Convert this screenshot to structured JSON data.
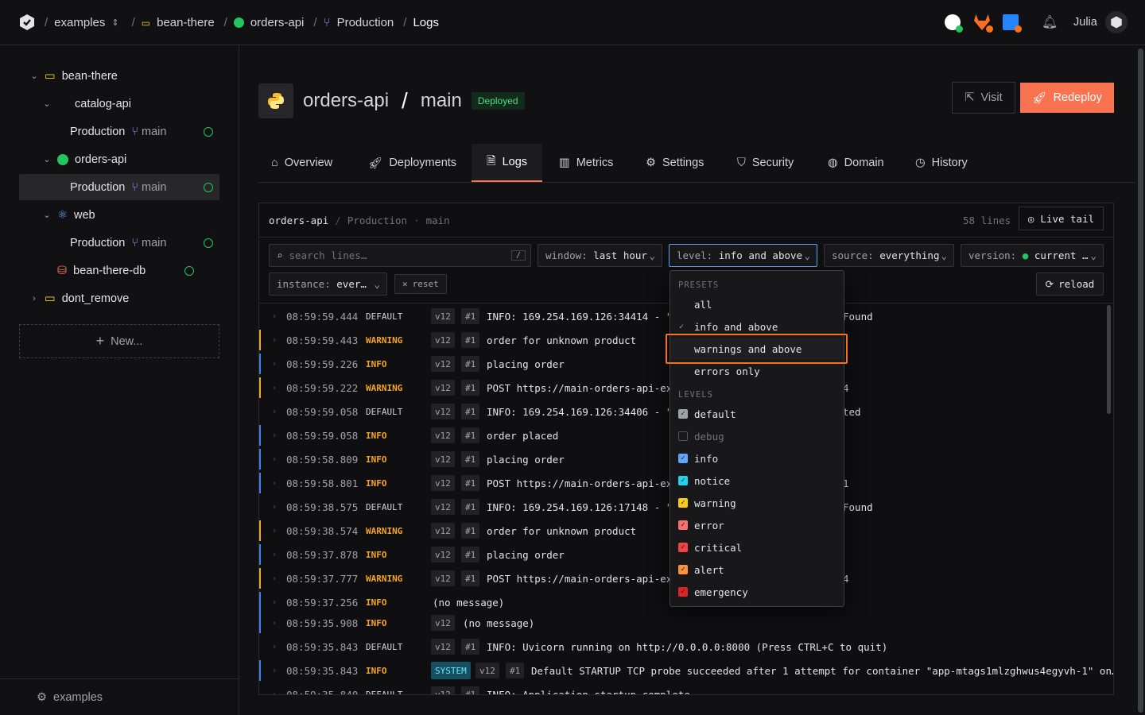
{
  "breadcrumb": {
    "org": "examples",
    "project": "bean-there",
    "service": "orders-api",
    "env": "Production",
    "page": "Logs"
  },
  "user": {
    "name": "Julia"
  },
  "sidebar": {
    "tree": [
      {
        "label": "bean-there"
      },
      {
        "label": "catalog-api"
      },
      {
        "label": "Production",
        "branch": "main"
      },
      {
        "label": "orders-api"
      },
      {
        "label": "Production",
        "branch": "main"
      },
      {
        "label": "web"
      },
      {
        "label": "Production",
        "branch": "main"
      },
      {
        "label": "bean-there-db"
      },
      {
        "label": "dont_remove"
      }
    ],
    "new_label": "New...",
    "footer": "examples"
  },
  "header": {
    "service": "orders-api",
    "slash": "/",
    "branch": "main",
    "status": "Deployed",
    "visit": "Visit",
    "redeploy": "Redeploy"
  },
  "tabs": [
    "Overview",
    "Deployments",
    "Logs",
    "Metrics",
    "Settings",
    "Security",
    "Domain",
    "History"
  ],
  "logs": {
    "path": {
      "service": "orders-api",
      "sep": "/",
      "env": "Production",
      "dot": "·",
      "branch": "main"
    },
    "lines": "58 lines",
    "live_tail": "Live tail",
    "search_placeholder": "search lines…",
    "slash_key": "/",
    "filters": {
      "window": {
        "key": "window:",
        "value": "last hour"
      },
      "level": {
        "key": "level:",
        "value": "info and above"
      },
      "source": {
        "key": "source:",
        "value": "everything"
      },
      "version": {
        "key": "version:",
        "value": "current …"
      },
      "instance": {
        "key": "instance:",
        "value": "ever…"
      }
    },
    "reset": "reset",
    "reload": "reload",
    "rows": [
      {
        "time": "08:59:59.444",
        "level": "DEFAULT",
        "ver": "v12",
        "inst": "#1",
        "msg": "INFO: 169.254.169.126:34414 - \"P",
        "tail": "Found"
      },
      {
        "time": "08:59:59.443",
        "level": "WARNING",
        "ver": "v12",
        "inst": "#1",
        "msg": "order for unknown product",
        "tail": ""
      },
      {
        "time": "08:59:59.226",
        "level": "INFO",
        "ver": "v12",
        "inst": "#1",
        "msg": "placing order",
        "tail": ""
      },
      {
        "time": "08:59:59.222",
        "level": "WARNING",
        "ver": "v12",
        "inst": "#1",
        "msg": "POST https://main-orders-api-exa",
        "tail": "4"
      },
      {
        "time": "08:59:59.058",
        "level": "DEFAULT",
        "ver": "v12",
        "inst": "#1",
        "msg": "INFO: 169.254.169.126:34406 - \"P",
        "tail": "ted"
      },
      {
        "time": "08:59:59.058",
        "level": "INFO",
        "ver": "v12",
        "inst": "#1",
        "msg": "order placed",
        "tail": ""
      },
      {
        "time": "08:59:58.809",
        "level": "INFO",
        "ver": "v12",
        "inst": "#1",
        "msg": "placing order",
        "tail": ""
      },
      {
        "time": "08:59:58.801",
        "level": "INFO",
        "ver": "v12",
        "inst": "#1",
        "msg": "POST https://main-orders-api-exa",
        "tail": "1"
      },
      {
        "time": "08:59:38.575",
        "level": "DEFAULT",
        "ver": "v12",
        "inst": "#1",
        "msg": "INFO: 169.254.169.126:17148 - \"P",
        "tail": "Found"
      },
      {
        "time": "08:59:38.574",
        "level": "WARNING",
        "ver": "v12",
        "inst": "#1",
        "msg": "order for unknown product",
        "tail": ""
      },
      {
        "time": "08:59:37.878",
        "level": "INFO",
        "ver": "v12",
        "inst": "#1",
        "msg": "placing order",
        "tail": ""
      },
      {
        "time": "08:59:37.777",
        "level": "WARNING",
        "ver": "v12",
        "inst": "#1",
        "msg": "POST https://main-orders-api-exa",
        "tail": "4"
      },
      {
        "time": "08:59:37.256",
        "level": "INFO",
        "ver": "",
        "inst": "",
        "msg": "(no message)",
        "tail": ""
      },
      {
        "time": "08:59:35.908",
        "level": "INFO",
        "ver": "v12",
        "inst": "",
        "msg": "(no message)",
        "tail": ""
      },
      {
        "time": "08:59:35.843",
        "level": "DEFAULT",
        "ver": "v12",
        "inst": "#1",
        "msg": "INFO: Uvicorn running on http://0.0.0.0:8000 (Press CTRL+C to quit)",
        "tail": ""
      },
      {
        "time": "08:59:35.843",
        "level": "INFO",
        "badge": "SYSTEM",
        "ver": "v12",
        "inst": "#1",
        "msg": "Default STARTUP TCP probe succeeded after 1 attempt for container \"app-mtags1mlzghwus4egyvh-1\" on…",
        "tail": ""
      },
      {
        "time": "08:59:35.840",
        "level": "DEFAULT",
        "ver": "v12",
        "inst": "#1",
        "msg": "INFO: Application startup complete.",
        "tail": ""
      }
    ]
  },
  "dropdown": {
    "presets_header": "PRESETS",
    "presets": [
      "all",
      "info and above",
      "warnings and above",
      "errors only"
    ],
    "levels_header": "LEVELS",
    "levels": [
      {
        "label": "default",
        "color": "#a1a1aa",
        "checked": true
      },
      {
        "label": "debug",
        "color": "#52525b",
        "checked": false
      },
      {
        "label": "info",
        "color": "#60a5fa",
        "checked": true
      },
      {
        "label": "notice",
        "color": "#22d3ee",
        "checked": true
      },
      {
        "label": "warning",
        "color": "#facc15",
        "checked": true
      },
      {
        "label": "error",
        "color": "#f87171",
        "checked": true
      },
      {
        "label": "critical",
        "color": "#ef4444",
        "checked": true
      },
      {
        "label": "alert",
        "color": "#fb923c",
        "checked": true
      },
      {
        "label": "emergency",
        "color": "#dc2626",
        "checked": true
      }
    ]
  },
  "colors": {
    "accent": "#f97350",
    "warning": "#f5a524",
    "info": "#3b82f6",
    "ok": "#22c55e",
    "highlight": "#f97316"
  }
}
